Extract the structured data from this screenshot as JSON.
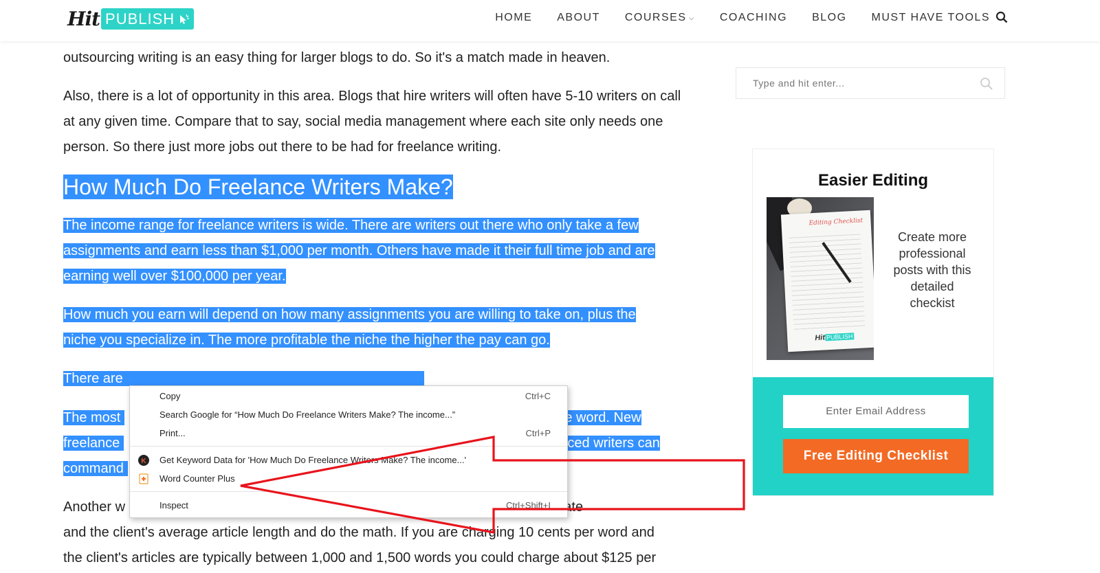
{
  "header": {
    "logo_hit": "Hit",
    "logo_publish": "PUBLISH",
    "nav": [
      {
        "label": "HOME"
      },
      {
        "label": "ABOUT"
      },
      {
        "label": "COURSES"
      },
      {
        "label": "COACHING"
      },
      {
        "label": "BLOG"
      },
      {
        "label": "MUST HAVE TOOLS"
      }
    ]
  },
  "article": {
    "p0": "outsourcing writing is an easy thing for larger blogs to do. So it's a match made in heaven.",
    "p1": "Also, there is a lot of opportunity in this area. Blogs that hire writers will often have 5-10 writers on call at any given time. Compare that to say, social media management where each site only needs one person. So there just more jobs out there to be had for freelance writing.",
    "heading": "How Much Do Freelance Writers Make?",
    "p2": "The income range for freelance writers is wide. There are writers out there who only take a few assignments and earn less than $1,000 per month. Others have made it their full time job and are earning well over $100,000 per year.",
    "p3": "How much you earn will depend on how many assignments you are willing to take on, plus the niche you specialize in. The more profitable the niche the higher the pay can go.",
    "p4_visible": "There are",
    "p5_start": "The most",
    "p5_end": "e word. New",
    "p5_line2_start": "freelance",
    "p5_line2_end": "nced writers can",
    "p5_line3_start": "command",
    "p6_line1_start": "Another w",
    "p6_line1_end": "r per word rate",
    "p6_line2": "and the client's average article length and do the math. If you are charging 10 cents per word and",
    "p6_line3": "the client's articles are typically between 1,000 and 1,500 words you could charge about $125 per"
  },
  "sidebar": {
    "search_placeholder": "Type and hit enter...",
    "widget_title": "Easier Editing",
    "widget_desc": "Create more professional posts with this detailed checkist",
    "email_placeholder": "Enter Email Address",
    "cta_label": "Free Editing Checklist"
  },
  "context_menu": {
    "items": [
      {
        "label": "Copy",
        "shortcut": "Ctrl+C"
      },
      {
        "label": "Search Google for “How Much Do Freelance Writers Make? The income...”",
        "shortcut": ""
      },
      {
        "label": "Print...",
        "shortcut": "Ctrl+P"
      },
      {
        "label": "Get Keyword Data for 'How Much Do Freelance Writers Make? The income...'",
        "shortcut": ""
      },
      {
        "label": "Word Counter Plus",
        "shortcut": ""
      },
      {
        "label": "Inspect",
        "shortcut": "Ctrl+Shift+I"
      }
    ]
  },
  "colors": {
    "selection": "#3390ff",
    "teal": "#22d2c6",
    "cta": "#f36a24",
    "arrow": "#e8141c"
  }
}
